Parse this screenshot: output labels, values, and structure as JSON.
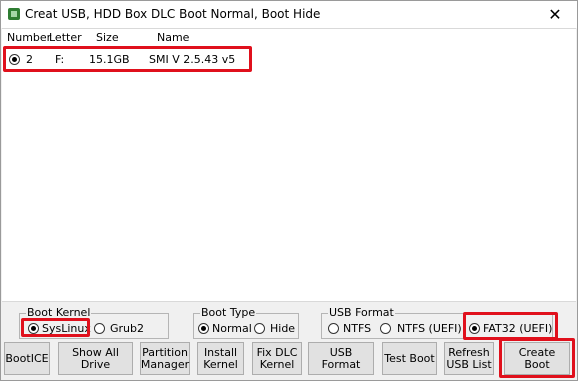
{
  "window": {
    "title": "Creat USB, HDD Box DLC Boot Normal, Boot Hide",
    "close_glyph": "✕"
  },
  "list": {
    "columns": [
      "Number",
      "Letter",
      "Size",
      "Name"
    ],
    "rows": [
      {
        "number": "2",
        "letter": "F:",
        "size": "15.1GB",
        "name": "SMI V 2.5.43 v5",
        "selected": true
      }
    ]
  },
  "boot_kernel": {
    "label": "Boot Kernel",
    "options": [
      "SysLinux",
      "Grub2"
    ],
    "selected": "SysLinux"
  },
  "boot_type": {
    "label": "Boot Type",
    "options": [
      "Normal",
      "Hide"
    ],
    "selected": "Normal"
  },
  "usb_format": {
    "label": "USB Format",
    "options": [
      "NTFS",
      "NTFS (UEFI)",
      "FAT32 (UEFI)"
    ],
    "selected": "FAT32 (UEFI)"
  },
  "buttons": {
    "booticce": "BootICE",
    "show_all_drive": "Show All Drive",
    "partition_manager": "Partition\nManager",
    "install_kernel": "Install\nKernel",
    "fix_dlc_kernel": "Fix DLC\nKernel",
    "usb_format": "USB Format",
    "test_boot": "Test Boot",
    "refresh_usb_list": "Refresh\nUSB List",
    "create_boot": "Create Boot"
  },
  "colors": {
    "highlight": "#e0101c",
    "window_bg": "#f0f0f0",
    "button_bg": "#e1e1e1"
  },
  "icons": {
    "app": "usb-tool-icon",
    "close": "close-icon"
  }
}
